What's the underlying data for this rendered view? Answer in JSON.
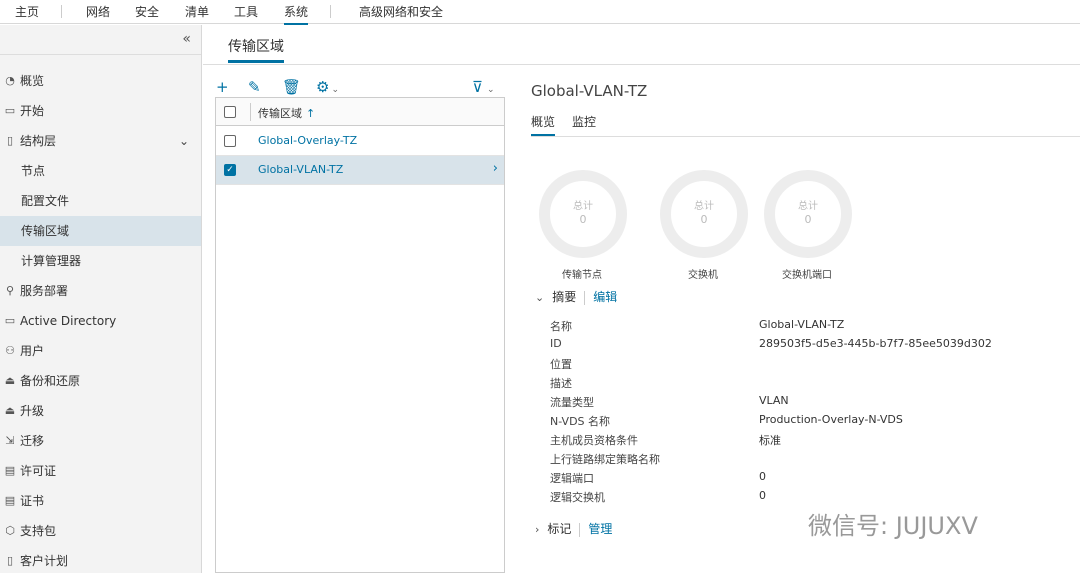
{
  "topnav": {
    "items": [
      "主页",
      "网络",
      "安全",
      "清单",
      "工具",
      "系统",
      "高级网络和安全"
    ],
    "active_index": 5
  },
  "sidebar": {
    "collapse_glyph": "«",
    "items": [
      {
        "label": "概览",
        "icon": "speedometer-icon"
      },
      {
        "label": "开始",
        "icon": "monitor-icon"
      },
      {
        "label": "结构层",
        "icon": "clipboard-icon"
      },
      {
        "label": "节点"
      },
      {
        "label": "配置文件"
      },
      {
        "label": "传输区域"
      },
      {
        "label": "计算管理器"
      },
      {
        "label": "服务部署",
        "icon": "deploy-icon"
      },
      {
        "label": "Active Directory",
        "icon": "folder-icon"
      },
      {
        "label": "用户",
        "icon": "users-icon"
      },
      {
        "label": "备份和还原",
        "icon": "backup-icon"
      },
      {
        "label": "升级",
        "icon": "upgrade-icon"
      },
      {
        "label": "迁移",
        "icon": "migrate-icon"
      },
      {
        "label": "许可证",
        "icon": "license-icon"
      },
      {
        "label": "证书",
        "icon": "certificate-icon"
      },
      {
        "label": "支持包",
        "icon": "package-icon"
      },
      {
        "label": "客户计划",
        "icon": "document-icon"
      }
    ],
    "selected": "传输区域"
  },
  "content": {
    "title": "传输区域"
  },
  "toolbar": {
    "icons": [
      "add-icon",
      "edit-icon",
      "delete-icon",
      "gear-icon",
      "filter-icon"
    ]
  },
  "grid": {
    "column": "传输区域",
    "sort_glyph": "↑",
    "rows": [
      {
        "name": "Global-Overlay-TZ",
        "checked": false
      },
      {
        "name": "Global-VLAN-TZ",
        "checked": true
      }
    ]
  },
  "detail": {
    "title": "Global-VLAN-TZ",
    "tabs": [
      "概览",
      "监控"
    ],
    "donuts": [
      {
        "title": "总计",
        "value": "0",
        "label": "传输节点"
      },
      {
        "title": "总计",
        "value": "0",
        "label": "交换机"
      },
      {
        "title": "总计",
        "value": "0",
        "label": "交换机端口"
      }
    ],
    "summary": {
      "heading": "摘要",
      "edit": "编辑",
      "fields": [
        {
          "label": "名称",
          "value": "Global-VLAN-TZ"
        },
        {
          "label": "ID",
          "value": "289503f5-d5e3-445b-b7f7-85ee5039d302"
        },
        {
          "label": "位置",
          "value": ""
        },
        {
          "label": "描述",
          "value": ""
        },
        {
          "label": "流量类型",
          "value": "VLAN"
        },
        {
          "label": "N-VDS 名称",
          "value": "Production-Overlay-N-VDS"
        },
        {
          "label": "主机成员资格条件",
          "value": "标准"
        },
        {
          "label": "上行链路绑定策略名称",
          "value": ""
        },
        {
          "label": "逻辑端口",
          "value": "0"
        },
        {
          "label": "逻辑交换机",
          "value": "0"
        }
      ]
    },
    "tags": {
      "heading": "标记",
      "manage": "管理"
    }
  },
  "watermark": "微信号: JUJUXV"
}
